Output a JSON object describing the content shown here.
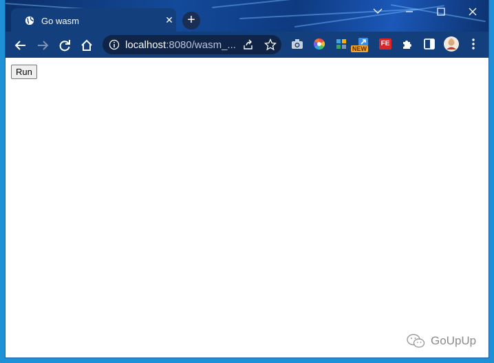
{
  "tab": {
    "title": "Go wasm",
    "favicon": "globe-icon",
    "close_icon": "close-icon"
  },
  "new_tab_label": "+",
  "window_controls": {
    "dropdown_icon": "chevron-down-icon",
    "minimize_icon": "minimize-icon",
    "maximize_icon": "maximize-icon",
    "close_icon": "close-icon"
  },
  "toolbar": {
    "back_icon": "back-arrow-icon",
    "forward_icon": "forward-arrow-icon",
    "reload_icon": "reload-icon",
    "home_icon": "home-icon",
    "address": {
      "info_icon": "info-icon",
      "host": "localhost",
      "rest": ":8080/wasm_...",
      "share_icon": "share-icon",
      "bookmark_icon": "star-icon"
    },
    "extensions": [
      {
        "name": "camera-icon"
      },
      {
        "name": "color-wheel-icon"
      },
      {
        "name": "puzzle-blocks-icon"
      },
      {
        "name": "arrow-new-icon",
        "badge": "NEW"
      },
      {
        "name": "fe-icon",
        "label": "FE"
      },
      {
        "name": "extensions-icon"
      },
      {
        "name": "side-panel-icon"
      },
      {
        "name": "avatar"
      },
      {
        "name": "menu-icon"
      }
    ]
  },
  "page": {
    "run_button_label": "Run"
  },
  "watermark": {
    "text": "GoUpUp",
    "icon": "wechat-icon"
  },
  "colors": {
    "titlebar": "#0e3a80",
    "toolbar": "#133f7c",
    "omnibox": "#0f2447",
    "desktop": "#1e90d6"
  }
}
